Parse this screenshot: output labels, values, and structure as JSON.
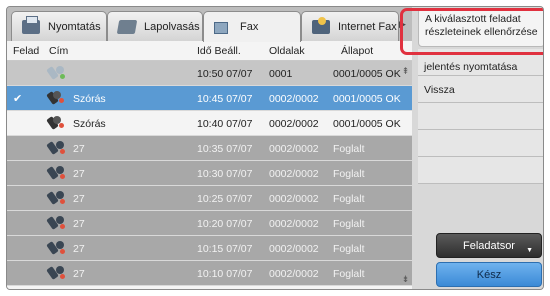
{
  "tabs": [
    {
      "label": "Nyomtatás",
      "icon": "printer-icon"
    },
    {
      "label": "Lapolvasás",
      "icon": "scanner-icon"
    },
    {
      "label": "Fax",
      "icon": "fax-icon"
    },
    {
      "label": "Internet Fax",
      "icon": "internet-fax-icon"
    }
  ],
  "active_tab": "Fax",
  "columns": {
    "felad": "Felad",
    "cim": "Cím",
    "ido": "Idő Beáll.",
    "oldalak": "Oldalak",
    "allapot": "Állapot"
  },
  "rows": [
    {
      "checked": false,
      "icon": "fax-sent-icon",
      "cim": "",
      "ido": "10:50 07/07",
      "oldalak": "0001",
      "allapot": "0001/0005 OK",
      "state": "grey"
    },
    {
      "checked": true,
      "icon": "broadcast-icon",
      "cim": "Szórás",
      "ido": "10:45 07/07",
      "oldalak": "0002/0002",
      "allapot": "0001/0005 OK",
      "state": "selected"
    },
    {
      "checked": false,
      "icon": "broadcast-icon",
      "cim": "Szórás",
      "ido": "10:40 07/07",
      "oldalak": "0002/0002",
      "allapot": "0001/0005 OK",
      "state": "normal"
    },
    {
      "checked": false,
      "icon": "fax-job-icon",
      "cim": "27",
      "ido": "10:35 07/07",
      "oldalak": "0002/0002",
      "allapot": "Foglalt",
      "state": "busy"
    },
    {
      "checked": false,
      "icon": "fax-job-icon",
      "cim": "27",
      "ido": "10:30 07/07",
      "oldalak": "0002/0002",
      "allapot": "Foglalt",
      "state": "busy"
    },
    {
      "checked": false,
      "icon": "fax-job-icon",
      "cim": "27",
      "ido": "10:25 07/07",
      "oldalak": "0002/0002",
      "allapot": "Foglalt",
      "state": "busy"
    },
    {
      "checked": false,
      "icon": "fax-job-icon",
      "cim": "27",
      "ido": "10:20 07/07",
      "oldalak": "0002/0002",
      "allapot": "Foglalt",
      "state": "busy"
    },
    {
      "checked": false,
      "icon": "fax-job-icon",
      "cim": "27",
      "ido": "10:15 07/07",
      "oldalak": "0002/0002",
      "allapot": "Foglalt",
      "state": "busy"
    },
    {
      "checked": false,
      "icon": "fax-job-icon",
      "cim": "27",
      "ido": "10:10 07/07",
      "oldalak": "0002/0002",
      "allapot": "Foglalt",
      "state": "busy"
    }
  ],
  "side_menu": {
    "check_details": "A kiválasztott feladat részleteinek ellenőrzése",
    "print_report": "jelentés nyomtatása",
    "back": "Vissza"
  },
  "buttons": {
    "job_queue": "Feladatsor",
    "done": "Kész"
  },
  "colors": {
    "selected_row": "#5a9ad3",
    "highlight_ring": "#e0313f",
    "done_button": "#3b8ad6"
  }
}
